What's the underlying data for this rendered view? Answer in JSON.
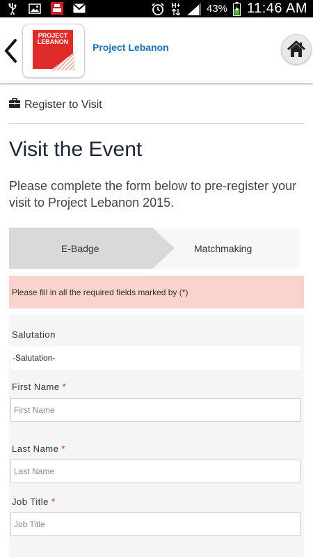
{
  "status_bar": {
    "time": "11:46 AM",
    "battery_percent": "43%",
    "network_type": "H+",
    "icons": [
      "usb-icon",
      "image-icon",
      "app-notification-icon",
      "gmail-icon",
      "alarm-icon",
      "network-icon",
      "signal-icon",
      "battery-icon"
    ]
  },
  "header": {
    "logo_text": "PROJECT LEBANON",
    "title": "Project Lebanon"
  },
  "breadcrumb": {
    "label": "Register to Visit"
  },
  "page": {
    "title": "Visit the Event",
    "intro": "Please complete the form below to pre-register your visit to Project Lebanon 2015."
  },
  "steps": [
    {
      "label": "E-Badge",
      "active": true
    },
    {
      "label": "Matchmaking",
      "active": false
    }
  ],
  "alert": {
    "text": "Please fill in all the required fields marked by (*)"
  },
  "form": {
    "salutation": {
      "label": "Salutation",
      "value": "-Salutation-"
    },
    "first_name": {
      "label": "First Name",
      "required": "*",
      "placeholder": "First Name",
      "value": ""
    },
    "last_name": {
      "label": "Last Name",
      "required": "*",
      "placeholder": "Last Name",
      "value": ""
    },
    "job_title": {
      "label": "Job Title",
      "required": "*",
      "placeholder": "Job Title",
      "value": ""
    }
  },
  "colors": {
    "accent_blue": "#1a6fb5",
    "brand_red": "#e02b2b",
    "alert_bg": "#fad3cd",
    "required_red": "#cc2222"
  }
}
